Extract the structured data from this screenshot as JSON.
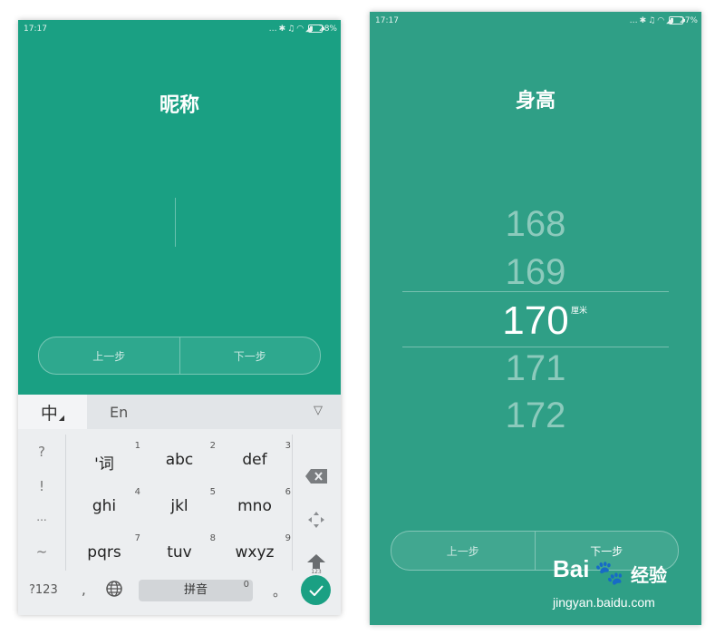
{
  "left": {
    "status": {
      "time": "17:17",
      "battery_pct": "28%",
      "battery_level": 0.28,
      "icons": [
        "more-icon",
        "bluetooth-icon",
        "mute-icon",
        "wifi-icon",
        "signal-icon"
      ]
    },
    "title": "昵称",
    "nav": {
      "prev": "上一步",
      "next": "下一步"
    },
    "keyboard": {
      "mode_chinese": "中",
      "mode_english": "En",
      "collapse": "▽",
      "symbols": [
        "?",
        "!",
        "...",
        "~"
      ],
      "keys": [
        {
          "label": "'词",
          "num": "1"
        },
        {
          "label": "abc",
          "num": "2"
        },
        {
          "label": "def",
          "num": "3"
        },
        {
          "label": "ghi",
          "num": "4"
        },
        {
          "label": "jkl",
          "num": "5"
        },
        {
          "label": "mno",
          "num": "6"
        },
        {
          "label": "pqrs",
          "num": "7"
        },
        {
          "label": "tuv",
          "num": "8"
        },
        {
          "label": "wxyz",
          "num": "9"
        }
      ],
      "shift_sub": "123",
      "numeric_switch": "?123",
      "comma": ",",
      "space_label": "拼音",
      "space_num": "0",
      "period": "。",
      "accent_color": "#1aa083"
    }
  },
  "right": {
    "status": {
      "time": "17:17",
      "battery_pct": "27%",
      "battery_level": 0.27,
      "icons": [
        "more-icon",
        "bluetooth-icon",
        "mute-icon",
        "wifi-icon",
        "signal-icon"
      ]
    },
    "title": "身高",
    "picker": {
      "values": [
        "168",
        "169",
        "170",
        "171",
        "172"
      ],
      "selected": "170",
      "unit": "厘米"
    },
    "nav": {
      "prev": "上一步",
      "next": "下一步"
    }
  },
  "watermark": {
    "brand_bai": "Bai",
    "brand_jingyan": "经验",
    "url": "jingyan.baidu.com"
  }
}
